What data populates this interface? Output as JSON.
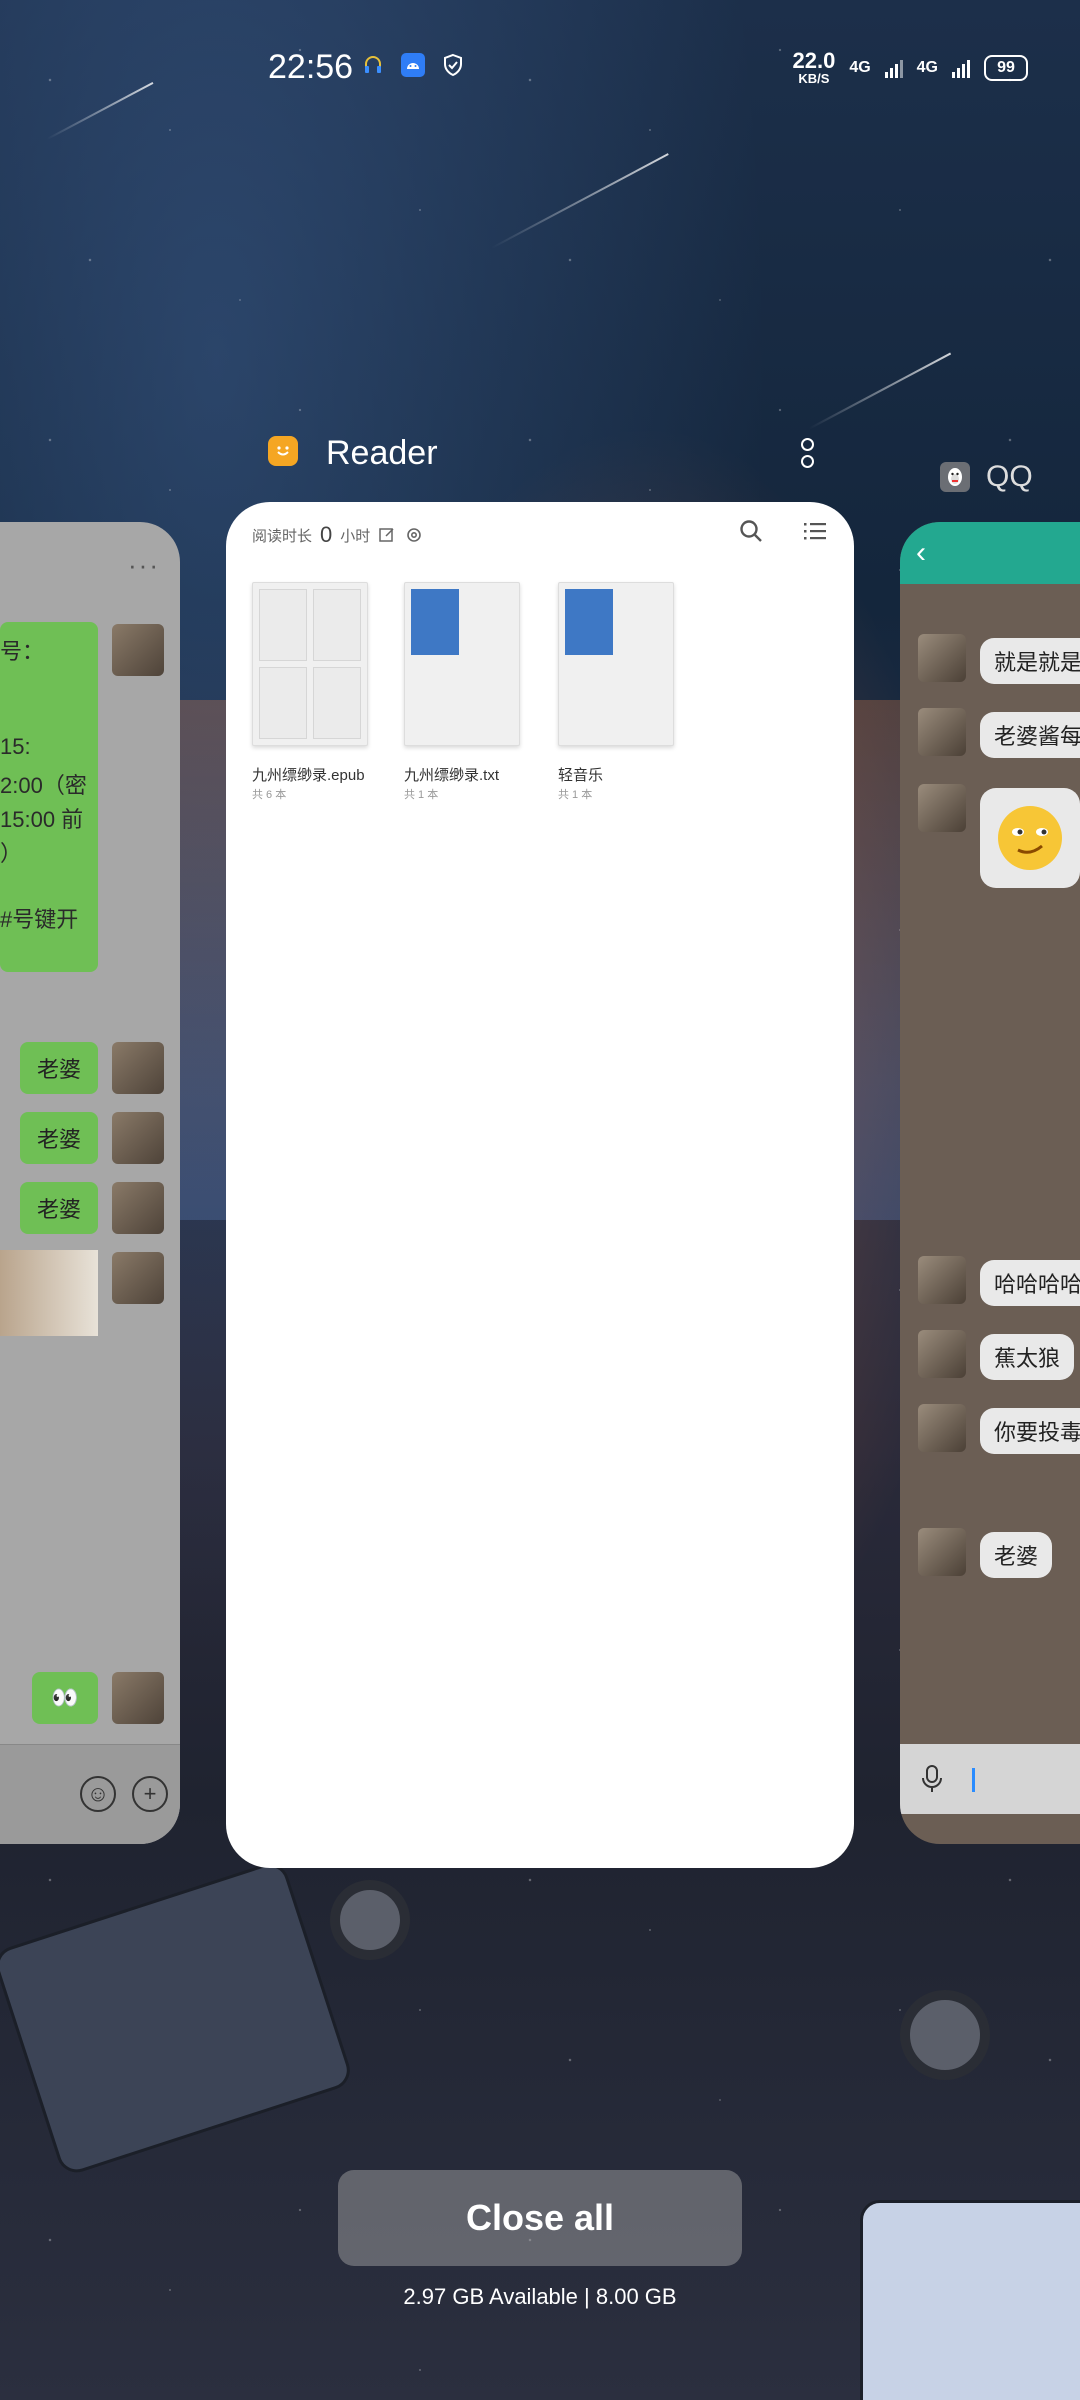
{
  "status_bar": {
    "time": "22:56",
    "icons": [
      "headset-icon",
      "android-icon",
      "shield-icon"
    ],
    "network_speed_value": "22.0",
    "network_speed_unit": "KB/S",
    "network_1": "4G",
    "network_2": "4G",
    "battery": "99"
  },
  "recents": {
    "center_app": {
      "name": "Reader",
      "icon": "reader-smile-icon",
      "reading_label_prefix": "阅读时长",
      "reading_hours": "0",
      "reading_label_suffix": "小时",
      "books": [
        {
          "title": "九州缥缈录.epub",
          "count": "共 6 本"
        },
        {
          "title": "九州缥缈录.txt",
          "count": "共 1 本"
        },
        {
          "title": "轻音乐",
          "count": "共 1 本"
        }
      ]
    },
    "right_app": {
      "name": "QQ",
      "messages": [
        "就是就是",
        "老婆酱每",
        "哈哈哈哈",
        "蕉太狼",
        "你要投毒",
        "老婆"
      ]
    },
    "left_app": {
      "text_lines": [
        "号：",
        "15:",
        "2:00（密",
        "15:00 前",
        "）",
        "#号键开"
      ],
      "short_messages": [
        "老婆",
        "老婆",
        "老婆"
      ],
      "emoji_message": "👀"
    }
  },
  "actions": {
    "close_all": "Close all",
    "memory_info": "2.97 GB Available | 8.00 GB"
  }
}
